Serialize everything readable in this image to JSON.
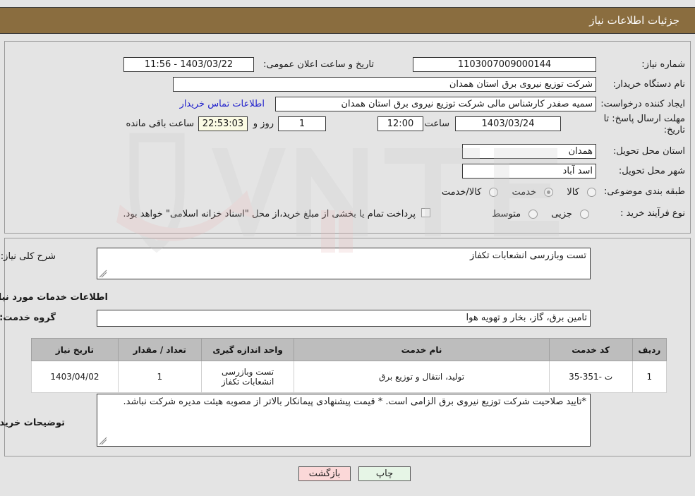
{
  "header": {
    "title": "جزئیات اطلاعات نیاز"
  },
  "form": {
    "need_number_label": "شماره نیاز:",
    "need_number_value": "1103007009000144",
    "announce_datetime_label": "تاریخ و ساعت اعلان عمومی:",
    "announce_datetime_value": "1403/03/22 - 11:56",
    "buyer_org_label": "نام دستگاه خریدار:",
    "buyer_org_value": "شرکت توزیع نیروی برق استان همدان",
    "requester_label": "ایجاد کننده درخواست:",
    "requester_value": "سمیه صفدر کارشناس مالی شرکت توزیع نیروی برق استان همدان",
    "contact_link": "اطلاعات تماس خریدار",
    "deadline_label": "مهلت ارسال پاسخ: تا تاریخ:",
    "deadline_date": "1403/03/24",
    "deadline_hour_label": "ساعت",
    "deadline_hour_value": "12:00",
    "remaining_days_value": "1",
    "remaining_days_label": "روز و",
    "remaining_time_value": "22:53:03",
    "remaining_time_label": "ساعت باقی مانده",
    "province_label": "استان محل تحویل:",
    "province_value": "همدان",
    "city_label": "شهر محل تحویل:",
    "city_value": "اسد آباد",
    "category_label": "طبقه بندی موضوعی:",
    "category_options": [
      {
        "label": "کالا",
        "checked": false
      },
      {
        "label": "خدمت",
        "checked": true
      },
      {
        "label": "کالا/خدمت",
        "checked": false
      }
    ],
    "purchase_type_label": "نوع فرآیند خرید :",
    "purchase_type_options": [
      {
        "label": "جزیی",
        "checked": false
      },
      {
        "label": "متوسط",
        "checked": false
      }
    ],
    "payment_checkbox_checked": false,
    "payment_note": "پرداخت تمام یا بخشی از مبلغ خرید،از محل \"اسناد خزانه اسلامی\" خواهد بود."
  },
  "description": {
    "general_need_label": "شرح کلی نیاز:",
    "general_need_value": "تست وبازرسی انشعابات تکفاز",
    "services_info_title": "اطلاعات خدمات مورد نیاز",
    "service_group_label": "گروه خدمت:",
    "service_group_value": "تامین برق، گاز، بخار و تهویه هوا"
  },
  "table": {
    "columns": [
      "ردیف",
      "کد خدمت",
      "نام خدمت",
      "واحد اندازه گیری",
      "تعداد / مقدار",
      "تاریخ نیاز"
    ],
    "rows": [
      {
        "index": "1",
        "service_code": "ت -351-35",
        "service_name": "تولید، انتقال و توزیع برق",
        "unit": "تست وبازرسی انشعابات تکفاز",
        "quantity": "1",
        "need_date": "1403/04/02"
      }
    ]
  },
  "buyer_notes": {
    "label": "توضیحات خریدار:",
    "value": "*تایید صلاحیت شرکت توزیع نیروی برق الزامی است. * قیمت پیشنهادی پیمانکار بالاتر از مصوبه هیئت مدیره شرکت نباشد."
  },
  "buttons": {
    "print": "چاپ",
    "back": "بازگشت"
  },
  "watermark": {
    "text": "AnaTender.net"
  },
  "colors": {
    "header_brown": "#8a6d3f",
    "page_bg": "#e4e4e4",
    "link_blue": "#2222cc",
    "table_header_gray": "#bdbdbd",
    "print_btn_green": "#e6f5e6",
    "back_btn_red": "#fbd8d8",
    "highlight_yellow": "#fbfbe4"
  }
}
